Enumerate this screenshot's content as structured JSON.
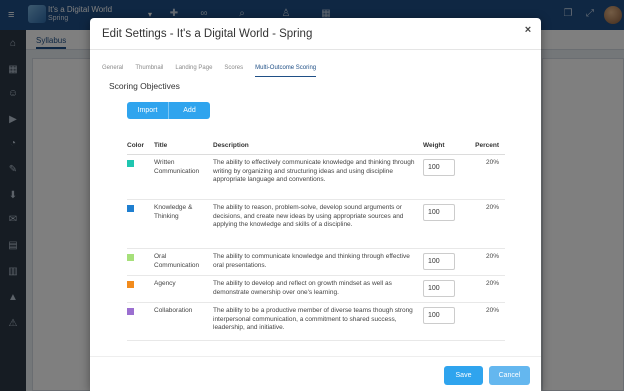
{
  "app": {
    "course_title": "It's a Digital World",
    "course_subtitle": "Spring",
    "syllabus_tab": "Syllabus"
  },
  "modal": {
    "title": "Edit Settings - It's a Digital World - Spring",
    "close_glyph": "×",
    "tabs": [
      {
        "label": "General",
        "active": false
      },
      {
        "label": "Thumbnail",
        "active": false
      },
      {
        "label": "Landing Page",
        "active": false
      },
      {
        "label": "Scores",
        "active": false
      },
      {
        "label": "Multi-Outcome Scoring",
        "active": true
      }
    ],
    "section_heading": "Scoring Objectives",
    "import_label": "Import",
    "add_label": "Add",
    "save_label": "Save",
    "cancel_label": "Cancel"
  },
  "table": {
    "headers": {
      "color": "Color",
      "title": "Title",
      "description": "Description",
      "weight": "Weight",
      "percent": "Percent"
    },
    "rows": [
      {
        "color": "#1fc6b0",
        "title": "Written Communication",
        "description": "The ability to effectively communicate knowledge and thinking through writing by organizing and structuring ideas and using discipline appropriate language and conventions.",
        "weight": "100",
        "percent": "20%"
      },
      {
        "color": "#1f7fd0",
        "title": "Knowledge & Thinking",
        "description": "The ability to reason, problem-solve, develop sound arguments or decisions, and create new ideas by using appropriate sources and applying the knowledge and skills of a discipline.",
        "weight": "100",
        "percent": "20%"
      },
      {
        "color": "#a6e07a",
        "title": "Oral Communication",
        "description": "The ability to communicate knowledge and thinking through effective oral presentations.",
        "weight": "100",
        "percent": "20%"
      },
      {
        "color": "#f28b1c",
        "title": "Agency",
        "description": "The ability to develop and reflect on growth mindset as well as demonstrate ownership over one's learning.",
        "weight": "100",
        "percent": "20%"
      },
      {
        "color": "#9b6fd0",
        "title": "Collaboration",
        "description": "The ability to be a productive member of diverse teams though strong interpersonal communication, a commitment to shared success, leadership, and initiative.",
        "weight": "100",
        "percent": "20%"
      }
    ]
  },
  "icons": {
    "menu": "≡",
    "caret": "▾",
    "nav": [
      "⌂",
      "▦",
      "☺",
      "▶",
      "◔",
      "✎",
      "⬇",
      "✉",
      "▤",
      "▥",
      "▲",
      "⚠"
    ]
  }
}
